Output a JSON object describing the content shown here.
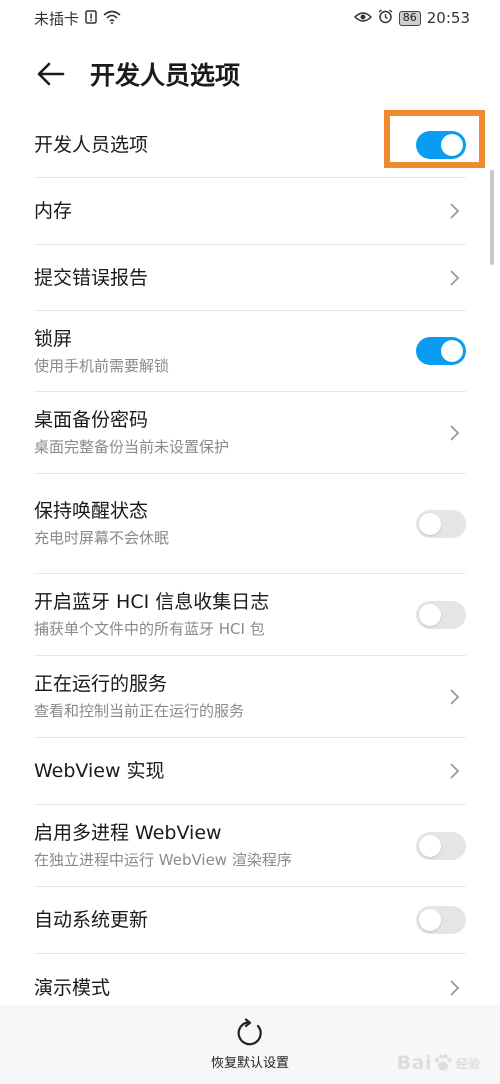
{
  "status_bar": {
    "carrier": "未插卡",
    "alert_icon": "sim-alert-icon",
    "wifi_icon": "wifi-icon",
    "eye_icon": "eye-comfort-icon",
    "alarm_icon": "alarm-icon",
    "battery": "86",
    "time": "20:53"
  },
  "header": {
    "back_icon": "arrow-left-icon",
    "title": "开发人员选项"
  },
  "items": [
    {
      "title": "开发人员选项",
      "subtitle": "",
      "control": "toggle",
      "on": true
    },
    {
      "title": "内存",
      "subtitle": "",
      "control": "chevron"
    },
    {
      "title": "提交错误报告",
      "subtitle": "",
      "control": "chevron"
    },
    {
      "title": "锁屏",
      "subtitle": "使用手机前需要解锁",
      "control": "toggle",
      "on": true
    },
    {
      "title": "桌面备份密码",
      "subtitle": "桌面完整备份当前未设置保护",
      "control": "chevron"
    },
    {
      "title": "保持唤醒状态",
      "subtitle": "充电时屏幕不会休眠",
      "control": "toggle",
      "on": false
    },
    {
      "title": "开启蓝牙 HCI 信息收集日志",
      "subtitle": "捕获单个文件中的所有蓝牙 HCI 包",
      "control": "toggle",
      "on": false
    },
    {
      "title": "正在运行的服务",
      "subtitle": "查看和控制当前正在运行的服务",
      "control": "chevron"
    },
    {
      "title": "WebView 实现",
      "subtitle": "",
      "control": "chevron"
    },
    {
      "title": "启用多进程 WebView",
      "subtitle": "在独立进程中运行 WebView 渲染程序",
      "control": "toggle",
      "on": false
    },
    {
      "title": "自动系统更新",
      "subtitle": "",
      "control": "toggle",
      "on": false
    },
    {
      "title": "演示模式",
      "subtitle": "",
      "control": "chevron"
    }
  ],
  "bottom_bar": {
    "restore_icon": "refresh-icon",
    "restore_label": "恢复默认设置"
  },
  "watermark": {
    "logo": "Bai",
    "text": "经验"
  },
  "colors": {
    "toggle_on": "#0a9cf0",
    "toggle_off": "#e5e5e5",
    "highlight": "#f08a30"
  }
}
